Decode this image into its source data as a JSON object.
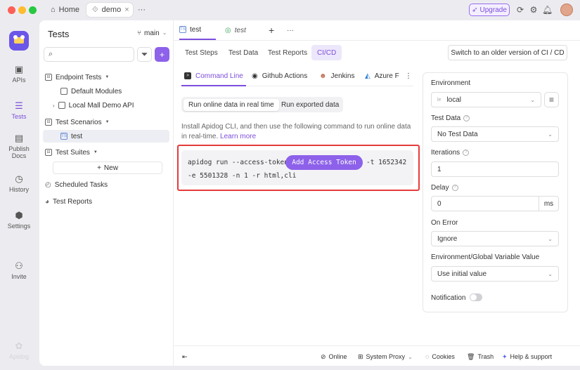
{
  "titlebar": {
    "home_label": "Home",
    "tab_label": "demo",
    "more": "···",
    "upgrade_label": "Upgrade"
  },
  "rail": {
    "apis": "APIs",
    "tests": "Tests",
    "publish_docs_line1": "Publish",
    "publish_docs_line2": "Docs",
    "history": "History",
    "settings": "Settings",
    "invite": "Invite",
    "brand": "Apidog"
  },
  "sidebar": {
    "title": "Tests",
    "branch": "main",
    "endpoint_tests": "Endpoint Tests",
    "default_modules": "Default Modules",
    "local_mall": "Local Mall Demo API",
    "test_scenarios": "Test Scenarios",
    "test_item": "test",
    "test_suites": "Test Suites",
    "new_label": "New",
    "scheduled_tasks": "Scheduled Tasks",
    "test_reports": "Test Reports"
  },
  "tabs": {
    "tab1": "test",
    "tab2": "test",
    "add": "+",
    "more": "···"
  },
  "subtabs": {
    "steps": "Test Steps",
    "data": "Test Data",
    "reports": "Test Reports",
    "cicd": "CI/CD",
    "older": "Switch to an older version of CI / CD"
  },
  "ci_tabs": {
    "command_line": "Command Line",
    "github": "Github Actions",
    "jenkins": "Jenkins",
    "azure": "Azure F"
  },
  "run_mode": {
    "online": "Run online data in real time",
    "exported": "Run exported data"
  },
  "description": {
    "text": "Install Apidog CLI, and then use the following command to run online data in real-time.",
    "link": "Learn more"
  },
  "command": {
    "part1": "apidog run --access-token",
    "token_button": "Add Access Token",
    "part2": "-t 1652342",
    "line2": "-e 5501328 -n 1 -r html,cli"
  },
  "settings_panel": {
    "environment_label": "Environment",
    "environment_value": "local",
    "test_data_label": "Test Data",
    "test_data_value": "No Test Data",
    "iterations_label": "Iterations",
    "iterations_value": "1",
    "delay_label": "Delay",
    "delay_value": "0",
    "delay_unit": "ms",
    "on_error_label": "On Error",
    "on_error_value": "Ignore",
    "env_var_label": "Environment/Global Variable Value",
    "env_var_value": "Use initial value",
    "notification_label": "Notification"
  },
  "status_bar": {
    "online": "Online",
    "proxy": "System Proxy",
    "cookies": "Cookies",
    "trash": "Trash",
    "help": "Help & support"
  },
  "colors": {
    "accent": "#7c4ddc",
    "token_button": "#8d61ea",
    "highlight_frame": "#e63b3b"
  }
}
